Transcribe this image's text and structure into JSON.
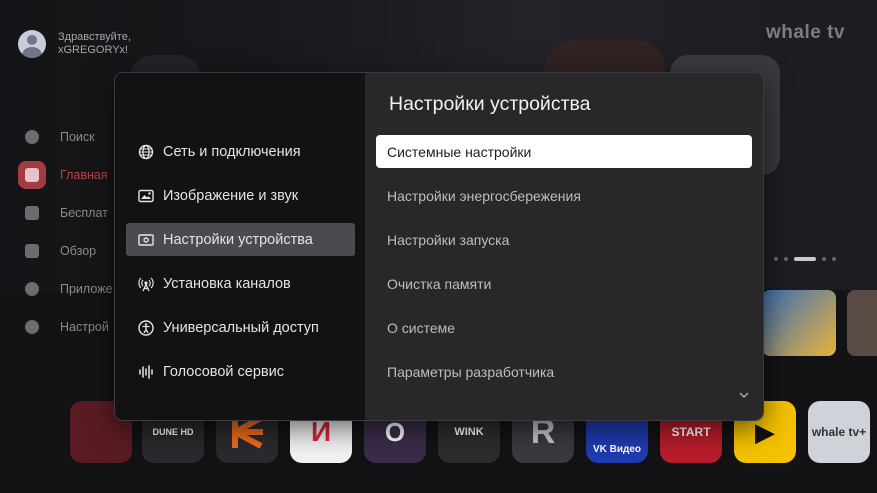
{
  "brand": "whale tv",
  "profile": {
    "greeting_line1": "Здравствуйте,",
    "greeting_line2": "xGREGORYx!"
  },
  "sidenav": {
    "items": [
      {
        "label": "Поиск",
        "icon": "search-icon"
      },
      {
        "label": "Главная",
        "icon": "home-icon",
        "active": true
      },
      {
        "label": "Бесплат",
        "icon": "free-tv-icon"
      },
      {
        "label": "Обзор",
        "icon": "explore-icon"
      },
      {
        "label": "Приложе",
        "icon": "apps-icon"
      },
      {
        "label": "Настрой",
        "icon": "settings-icon"
      }
    ]
  },
  "app_tiles": [
    {
      "label": ""
    },
    {
      "label": "DUNE HD"
    },
    {
      "label": ""
    },
    {
      "label": "И"
    },
    {
      "label": "О"
    },
    {
      "label": "WINK"
    },
    {
      "label": "R"
    },
    {
      "label": "VK Видео"
    },
    {
      "label": "START"
    },
    {
      "label": "▶"
    },
    {
      "label": "whale tv+"
    }
  ],
  "modal": {
    "title": "Настройки устройства",
    "categories": [
      {
        "label": "Сеть и подключения",
        "icon": "network-globe-icon"
      },
      {
        "label": "Изображение и звук",
        "icon": "picture-sound-icon"
      },
      {
        "label": "Настройки устройства",
        "icon": "device-settings-icon",
        "selected": true
      },
      {
        "label": "Установка каналов",
        "icon": "antenna-icon"
      },
      {
        "label": "Универсальный доступ",
        "icon": "accessibility-icon"
      },
      {
        "label": "Голосовой сервис",
        "icon": "voice-wave-icon"
      }
    ],
    "options": [
      {
        "label": "Системные настройки",
        "selected": true
      },
      {
        "label": "Настройки энергосбережения"
      },
      {
        "label": "Настройки запуска"
      },
      {
        "label": "Очистка памяти"
      },
      {
        "label": "О системе"
      },
      {
        "label": "Параметры разработчика"
      }
    ],
    "more_icon": "chevron-down-icon"
  },
  "colors": {
    "accent_home": "#a23b44",
    "selected_option_bg": "#ffffff",
    "selected_category_bg": "#4a4a4f",
    "modal_left_bg": "#121214",
    "modal_right_bg": "#28282b"
  }
}
